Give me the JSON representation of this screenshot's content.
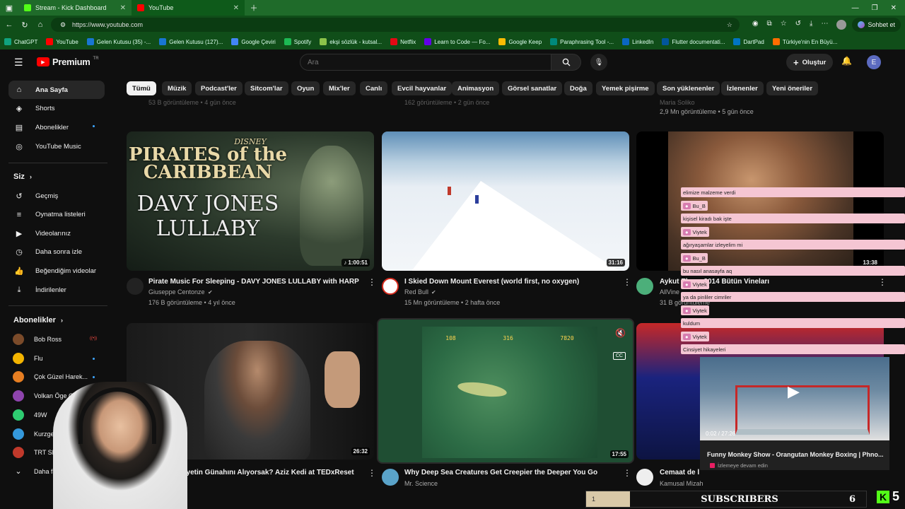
{
  "browser": {
    "tabs": [
      {
        "label": "Stream - Kick Dashboard",
        "icon": "kick-icon"
      },
      {
        "label": "YouTube",
        "icon": "youtube-icon"
      }
    ],
    "url": "https://www.youtube.com",
    "profile_button": "Sohbet et",
    "bookmarks": [
      "ChatGPT",
      "YouTube",
      "Gelen Kutusu (35) -...",
      "Gelen Kutusu (127)...",
      "Google Çeviri",
      "Spotify",
      "ekşi sözlük - kutsal...",
      "Netflix",
      "Learn to Code — Fo...",
      "Google Keep",
      "Paraphrasing Tool -...",
      "LinkedIn",
      "Flutter documentati...",
      "DartPad",
      "Türkiye'nin En Büyü..."
    ]
  },
  "yt": {
    "logo": "Premium",
    "logo_sup": "TR",
    "search_placeholder": "Ara",
    "create": "Oluştur",
    "avatar_letter": "E"
  },
  "chips": [
    "Tümü",
    "Müzik",
    "Podcast'ler",
    "Sitcom'lar",
    "Oyun",
    "Mix'ler",
    "Canlı",
    "Evcil hayvanlar",
    "Animasyon",
    "Görsel sanatlar",
    "Doğa",
    "Yemek pişirme",
    "Son yüklenenler",
    "İzlenenler",
    "Yeni öneriler"
  ],
  "sidebar": {
    "main": [
      "Ana Sayfa",
      "Shorts",
      "Abonelikler",
      "YouTube Music"
    ],
    "you_header": "Siz",
    "you": [
      "Geçmiş",
      "Oynatma listeleri",
      "Videolarınız",
      "Daha sonra izle",
      "Beğendiğim videolar",
      "İndirilenler"
    ],
    "subs_header": "Abonelikler",
    "subs": [
      "Bob Ross",
      "Flu",
      "Çok Güzel Harek...",
      "Volkan Öge Geliy...",
      "49W",
      "Kurzgesagt – In ...",
      "TRT SPOR Yıldız",
      "Daha fazla"
    ]
  },
  "top_row": {
    "partial_meta": [
      "53 B görüntüleme • 4 gün önce",
      "162 görüntüleme • 2 gün önce",
      "2,9 Mn görüntüleme • 5 gün önce"
    ],
    "partial_channel": "Maria Soliko"
  },
  "videos": [
    {
      "title": "Pirate Music For Sleeping - DAVY JONES LULLABY with HARP",
      "channel": "Giuseppe Centonze",
      "meta": "176 B görüntüleme • 4 yıl önce",
      "duration": "♪ 1:00:51",
      "thumb_text": [
        "DISNEY",
        "PIRATES of the",
        "CARIBBEAN",
        "DAVY JONES",
        "LULLABY"
      ]
    },
    {
      "title": "I Skied Down Mount Everest (world first, no oxygen)",
      "channel": "Red Bull",
      "meta": "15 Mn görüntüleme • 2 hafta önce",
      "duration": "31:16"
    },
    {
      "title": "Aykut Elmas 2014 Bütün Vineları",
      "channel": "AllVine",
      "meta": "31 B görüntüleme",
      "duration": "13:38"
    },
    {
      "title": "Ölübiyetin Günahını Alıyorsak? Aziz Kedi at TEDxReset",
      "channel": "TEDx Talks",
      "meta": "",
      "duration": "26:32"
    },
    {
      "title": "Why Deep Sea Creatures Get Creepier the Deeper You Go",
      "channel": "Mr. Science",
      "meta": "",
      "duration": "17:55"
    },
    {
      "title": "Cemaat de İ",
      "channel": "Kamusal Mizah",
      "meta": "",
      "duration": ""
    }
  ],
  "mini_player": {
    "time": "0:02 / 27:26",
    "title": "Funny Monkey Show - Orangutan Monkey Boxing | Phno...",
    "subtitle": "İzlemeye devam edin"
  },
  "hud": {
    "hud_numbers": [
      "316",
      "7820",
      "108"
    ]
  },
  "chat": [
    {
      "user": "",
      "text": "elimize malzeme verdi"
    },
    {
      "user": "Bu_B",
      "text": "kişisel kiradı bak işte"
    },
    {
      "user": "Viytek",
      "text": "ağıryaşamlar izleyelim mi"
    },
    {
      "user": "Bu_B",
      "text": "bu nasıl anasayfa aq"
    },
    {
      "user": "Viytek",
      "text": "ya da pinliler cimriler"
    },
    {
      "user": "Viytek",
      "text": "kuldum"
    },
    {
      "user": "Viytek",
      "text": "Cinsiyet hikayeleri"
    }
  ],
  "overlay": {
    "subscribers_label": "SUBSCRIBERS",
    "subscribers_count": "6",
    "goal_current": "1",
    "kick_count": "5"
  },
  "colors": {
    "yt_red": "#ff0000",
    "chrome_green": "#1f6b2a",
    "kick_green": "#53fc18",
    "chat_pink": "#f5c6d3"
  }
}
